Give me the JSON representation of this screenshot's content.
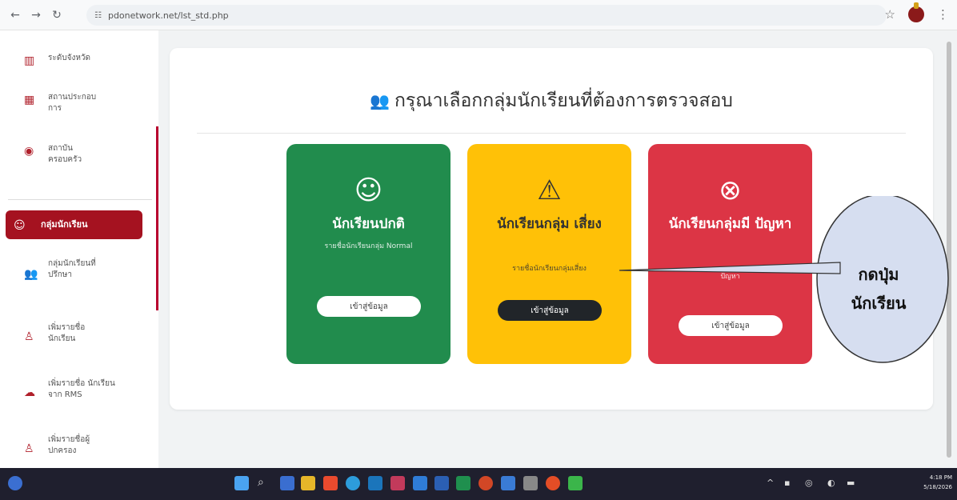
{
  "browser": {
    "url": "pdonetwork.net/lst_std.php"
  },
  "sidebar": {
    "items": [
      {
        "label": "ระดับจังหวัด",
        "icon": "chart-icon"
      },
      {
        "label": "สถานประกอบ การ",
        "icon": "building-icon"
      },
      {
        "label": "สถาบัน ครอบครัว",
        "icon": "home-icon"
      },
      {
        "label": "กลุ่มนักเรียน",
        "icon": "smile-icon",
        "active": true
      },
      {
        "label": "กลุ่มนักเรียนที่ ปรึกษา",
        "icon": "users-icon"
      },
      {
        "label": "เพิ่มรายชื่อ นักเรียน",
        "icon": "user-plus-icon"
      },
      {
        "label": "เพิ่มรายชื่อ นักเรียนจาก RMS",
        "icon": "cloud-upload-icon"
      },
      {
        "label": "เพิ่มรายชื่อผู้ ปกครอง",
        "icon": "user-plus-icon"
      }
    ]
  },
  "main": {
    "title": "กรุณาเลือกกลุ่มนักเรียนที่ต้องการตรวจสอบ",
    "cards": [
      {
        "title": "นักเรียนปกติ",
        "subtitle": "รายชื่อนักเรียนกลุ่ม Normal",
        "button": "เข้าสู่ข้อมูล",
        "color": "#218c4d"
      },
      {
        "title": "นักเรียนกลุ่ม เสี่ยง",
        "subtitle": "รายชื่อนักเรียนกลุ่มเสี่ยง",
        "button": "เข้าสู่ข้อมูล",
        "color": "#ffc107"
      },
      {
        "title": "นักเรียนกลุ่มมี ปัญหา",
        "subtitle": "ปัญหา",
        "button": "เข้าสู่ข้อมูล",
        "color": "#dc3545"
      }
    ]
  },
  "callout": {
    "text": "กดปุ่ม นักเรียน"
  },
  "taskbar": {
    "time": "4:18 PM",
    "date": "5/18/2026"
  }
}
